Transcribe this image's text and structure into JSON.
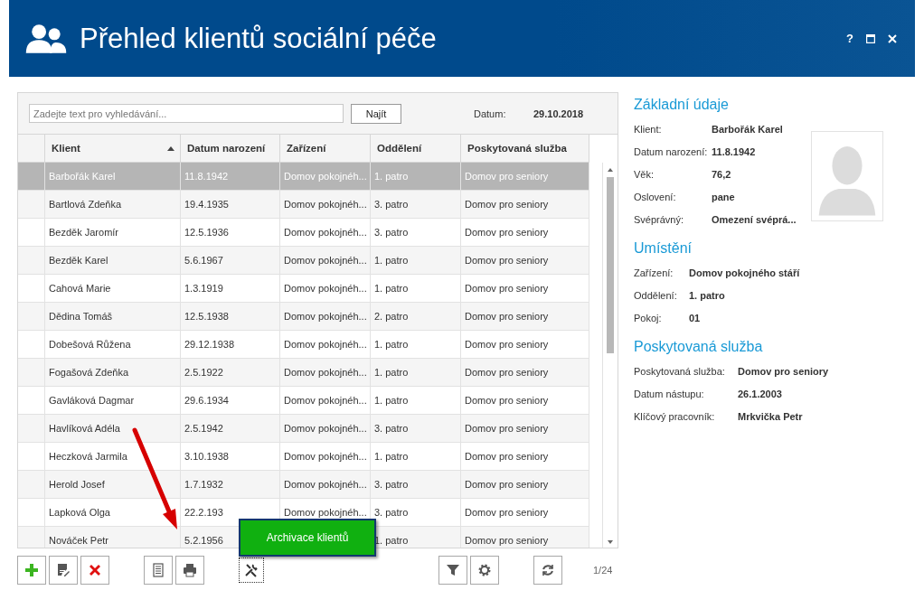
{
  "window": {
    "title": "Přehled klientů sociální péče",
    "help": "?"
  },
  "search": {
    "placeholder": "Zadejte text pro vyhledávání...",
    "button": "Najít",
    "date_label": "Datum:",
    "date_value": "29.10.2018"
  },
  "table": {
    "columns": [
      {
        "label": "Klient",
        "sorted": true
      },
      {
        "label": "Datum narození",
        "sorted": false
      },
      {
        "label": "Zařízení",
        "sorted": false
      },
      {
        "label": "Oddělení",
        "sorted": false
      },
      {
        "label": "Poskytovaná služba",
        "sorted": false
      }
    ],
    "rows": [
      {
        "cells": [
          "Barbořák Karel",
          "11.8.1942",
          "Domov pokojnéh...",
          "1. patro",
          "Domov pro seniory"
        ],
        "selected": true
      },
      {
        "cells": [
          "Bartlová Zdeňka",
          "19.4.1935",
          "Domov pokojnéh...",
          "3. patro",
          "Domov pro seniory"
        ],
        "selected": false
      },
      {
        "cells": [
          "Bezděk Jaromír",
          "12.5.1936",
          "Domov pokojnéh...",
          "3. patro",
          "Domov pro seniory"
        ],
        "selected": false
      },
      {
        "cells": [
          "Bezděk Karel",
          "5.6.1967",
          "Domov pokojnéh...",
          "1. patro",
          "Domov pro seniory"
        ],
        "selected": false
      },
      {
        "cells": [
          "Cahová Marie",
          "1.3.1919",
          "Domov pokojnéh...",
          "1. patro",
          "Domov pro seniory"
        ],
        "selected": false
      },
      {
        "cells": [
          "Dědina Tomáš",
          "12.5.1938",
          "Domov pokojnéh...",
          "2. patro",
          "Domov pro seniory"
        ],
        "selected": false
      },
      {
        "cells": [
          "Dobešová Růžena",
          "29.12.1938",
          "Domov pokojnéh...",
          "1. patro",
          "Domov pro seniory"
        ],
        "selected": false
      },
      {
        "cells": [
          "Fogašová Zdeňka",
          "2.5.1922",
          "Domov pokojnéh...",
          "1. patro",
          "Domov pro seniory"
        ],
        "selected": false
      },
      {
        "cells": [
          "Gavláková Dagmar",
          "29.6.1934",
          "Domov pokojnéh...",
          "1. patro",
          "Domov pro seniory"
        ],
        "selected": false
      },
      {
        "cells": [
          "Havlíková Adéla",
          "2.5.1942",
          "Domov pokojnéh...",
          "3. patro",
          "Domov pro seniory"
        ],
        "selected": false
      },
      {
        "cells": [
          "Heczková Jarmila",
          "3.10.1938",
          "Domov pokojnéh...",
          "1. patro",
          "Domov pro seniory"
        ],
        "selected": false
      },
      {
        "cells": [
          "Herold Josef",
          "1.7.1932",
          "Domov pokojnéh...",
          "3. patro",
          "Domov pro seniory"
        ],
        "selected": false
      },
      {
        "cells": [
          "Lapková Olga",
          "22.2.193",
          "Domov pokojnéh...",
          "3. patro",
          "Domov pro seniory"
        ],
        "selected": false
      },
      {
        "cells": [
          "Nováček Petr",
          "5.2.1956",
          null,
          "1. patro",
          "Domov pro seniory"
        ],
        "selected": false
      }
    ]
  },
  "toolbar": {
    "groups": [
      [
        {
          "kind": "add",
          "focused": false
        },
        {
          "kind": "edit",
          "focused": false
        },
        {
          "kind": "delete",
          "focused": false
        }
      ],
      [
        {
          "kind": "report",
          "focused": false
        },
        {
          "kind": "print",
          "focused": false
        }
      ],
      [
        {
          "kind": "tools",
          "focused": true
        }
      ],
      [
        {
          "kind": "filter",
          "focused": false
        },
        {
          "kind": "settings",
          "focused": false
        }
      ],
      [
        {
          "kind": "refresh",
          "focused": false
        }
      ]
    ],
    "page": "1/24"
  },
  "tooltip": {
    "text": "Archivace klientů"
  },
  "details": [
    {
      "title": "Základní údaje",
      "photo": true,
      "fields": [
        {
          "label": "Klient:",
          "value": "Barbořák Karel"
        },
        {
          "label": "Datum narození:",
          "value": "11.8.1942"
        },
        {
          "label": "Věk:",
          "value": "76,2"
        },
        {
          "label": "Oslovení:",
          "value": "pane"
        },
        {
          "label": "Svéprávný:",
          "value": "Omezení svéprá..."
        }
      ]
    },
    {
      "title": "Umístění",
      "fields": [
        {
          "label": "Zařízení:",
          "value": "Domov pokojného stáří"
        },
        {
          "label": "Oddělení:",
          "value": "1. patro"
        },
        {
          "label": "Pokoj:",
          "value": "01"
        }
      ]
    },
    {
      "title": "Poskytovaná služba",
      "fields": [
        {
          "label": "Poskytovaná služba:",
          "value": "Domov pro seniory"
        },
        {
          "label": "Datum nástupu:",
          "value": "26.1.2003"
        },
        {
          "label": "Klíčový pracovník:",
          "value": "Mrkvička Petr"
        }
      ]
    }
  ]
}
